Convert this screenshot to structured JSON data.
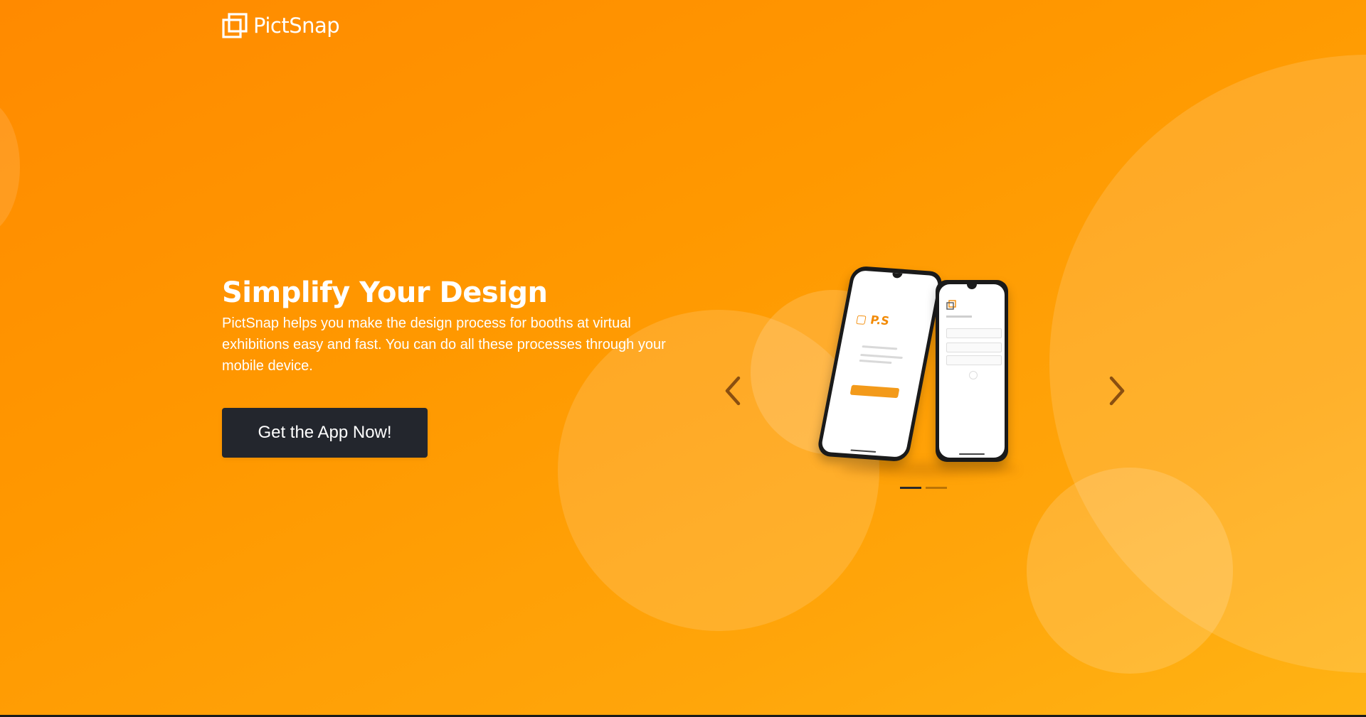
{
  "brand": {
    "name": "PictSnap",
    "icon": "overlapping-squares-logo-icon"
  },
  "hero": {
    "title": "Simplify Your Design",
    "description": "PictSnap helps you make the design process for booths at virtual exhibitions easy and fast. You can do all these processes through your mobile device.",
    "cta_label": "Get the App Now!"
  },
  "carousel": {
    "prev_icon": "chevron-left-icon",
    "next_icon": "chevron-right-icon",
    "active_slide": 1,
    "slide_count": 2,
    "slide_image": "two-smartphones-app-screens-image"
  },
  "colors": {
    "background_start": "#ff8a00",
    "background_end": "#ffb314",
    "cta_background": "#23262d",
    "text": "#ffffff",
    "accent": "#f28a05"
  }
}
